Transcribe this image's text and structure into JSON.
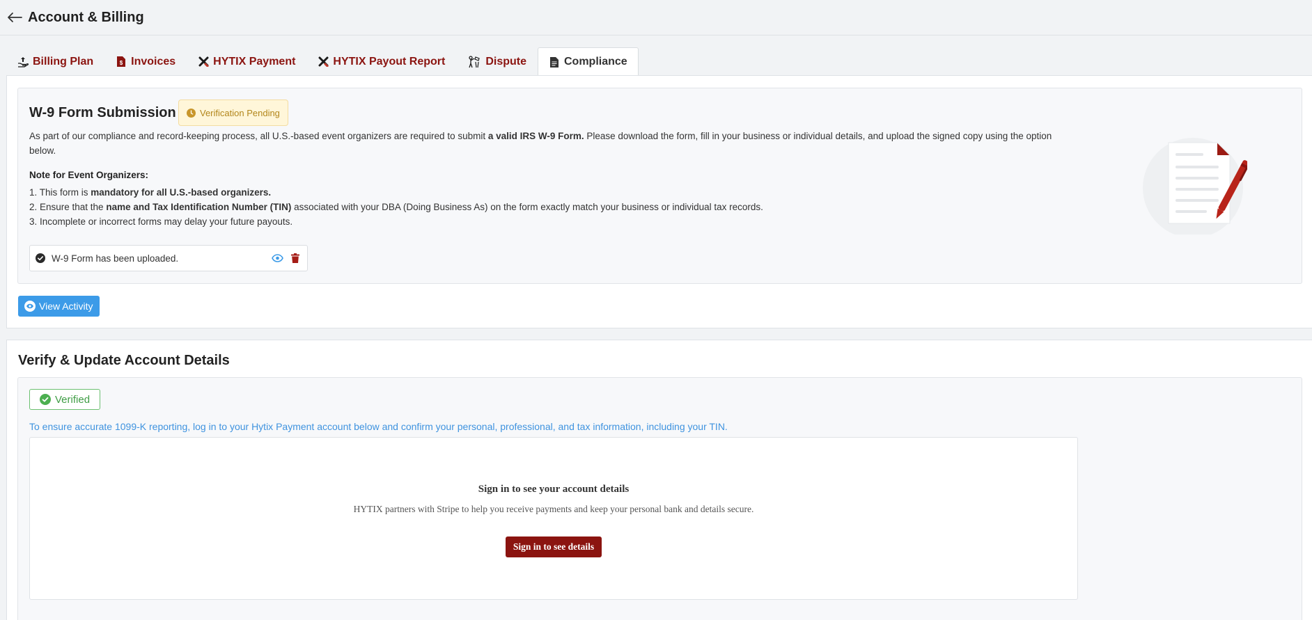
{
  "header": {
    "title": "Account & Billing",
    "back_icon": "arrow-left-icon"
  },
  "tabs": [
    {
      "label": "Billing Plan",
      "icon": "hand-upload-icon",
      "active": false
    },
    {
      "label": "Invoices",
      "icon": "invoice-icon",
      "active": false
    },
    {
      "label": "HYTIX Payment",
      "icon": "hytix-x-icon",
      "active": false
    },
    {
      "label": "HYTIX Payout Report",
      "icon": "hytix-x-icon",
      "active": false
    },
    {
      "label": "Dispute",
      "icon": "dispute-icon",
      "active": false
    },
    {
      "label": "Compliance",
      "icon": "file-text-icon",
      "active": true
    }
  ],
  "w9": {
    "title": "W-9 Form Submission",
    "status_badge": "Verification Pending",
    "desc_pre": "As part of our compliance and record-keeping process, all U.S.-based event organizers are required to submit ",
    "desc_bold": "a valid IRS W-9 Form.",
    "desc_post": " Please download the form, fill in your business or individual details, and upload the signed copy using the option below.",
    "note_title": "Note for Event Organizers:",
    "notes": [
      {
        "pre": "1. This form is ",
        "bold": "mandatory for all U.S.-based organizers.",
        "post": ""
      },
      {
        "pre": "2. Ensure that the ",
        "bold": "name and Tax Identification Number (TIN)",
        "post": " associated with your DBA (Doing Business As) on the form exactly match your business or individual tax records."
      },
      {
        "pre": "3. Incomplete or incorrect forms may delay your future payouts.",
        "bold": "",
        "post": ""
      }
    ],
    "upload_status": "W-9 Form has been uploaded."
  },
  "view_activity_label": "View Activity",
  "verify": {
    "title": "Verify & Update Account Details",
    "badge": "Verified",
    "info": "To ensure accurate 1099-K reporting, log in to your Hytix Payment account below and confirm your personal, professional, and tax information, including your TIN.",
    "signin_heading": "Sign in to see your account details",
    "signin_sub": "HYTIX partners with Stripe to help you receive payments and keep your personal bank and details secure.",
    "signin_button": "Sign in to see details"
  },
  "colors": {
    "brand": "#8b1410",
    "accent_blue": "#3c9be8",
    "pending_text": "#b2861b",
    "verified_green": "#3f9d45"
  }
}
